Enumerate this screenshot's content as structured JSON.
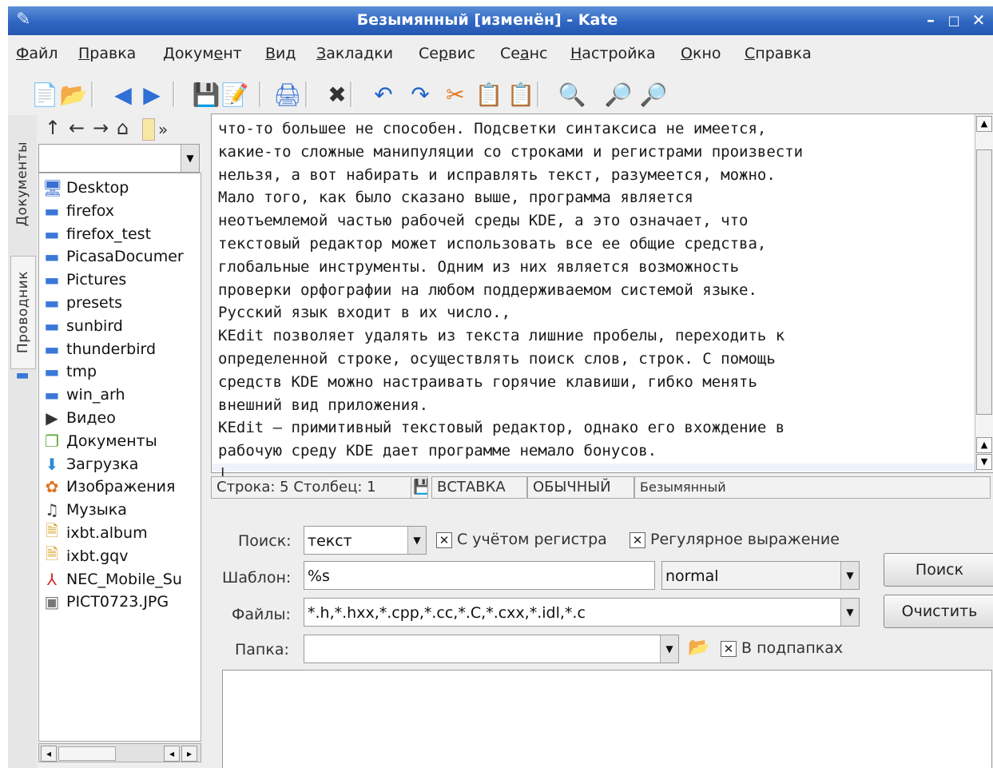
{
  "window": {
    "title": "Безымянный [изменён] - Kate",
    "controls": [
      "–",
      "□",
      "✕"
    ]
  },
  "menubar": [
    {
      "pre": "",
      "ul": "Ф",
      "post": "айл"
    },
    {
      "pre": "",
      "ul": "П",
      "post": "равка"
    },
    {
      "pre": "Докум",
      "ul": "е",
      "post": "нт"
    },
    {
      "pre": "",
      "ul": "В",
      "post": "ид"
    },
    {
      "pre": "",
      "ul": "З",
      "post": "акладки"
    },
    {
      "pre": "Се",
      "ul": "р",
      "post": "вис"
    },
    {
      "pre": "Се",
      "ul": "а",
      "post": "нс"
    },
    {
      "pre": "",
      "ul": "Н",
      "post": "астройка"
    },
    {
      "pre": "",
      "ul": "О",
      "post": "кно"
    },
    {
      "pre": "",
      "ul": "С",
      "post": "правка"
    }
  ],
  "toolbar": [
    {
      "icon": "new-document-icon",
      "glyph": "📄"
    },
    {
      "icon": "open-folder-icon",
      "glyph": "📂"
    },
    {
      "icon": "back-icon",
      "glyph": "◀"
    },
    {
      "icon": "forward-icon",
      "glyph": "▶"
    },
    {
      "icon": "save-icon",
      "glyph": "💾"
    },
    {
      "icon": "save-as-icon",
      "glyph": "📝"
    },
    {
      "icon": "print-icon",
      "glyph": "🖨"
    },
    {
      "icon": "close-document-icon",
      "glyph": "✖"
    },
    {
      "icon": "undo-icon",
      "glyph": "↶"
    },
    {
      "icon": "redo-icon",
      "glyph": "↷"
    },
    {
      "icon": "cut-icon",
      "glyph": "✂"
    },
    {
      "icon": "copy-icon",
      "glyph": "📋"
    },
    {
      "icon": "paste-icon",
      "glyph": "📋"
    },
    {
      "icon": "find-icon",
      "glyph": "🔍"
    },
    {
      "icon": "find-next-icon",
      "glyph": "🔎"
    },
    {
      "icon": "find-prev-icon",
      "glyph": "🔎"
    }
  ],
  "side_tabs": {
    "documents": "Документы",
    "explorer": "Проводник"
  },
  "file_browser": {
    "nav": [
      "↑",
      "←",
      "→",
      "⌂",
      "»"
    ],
    "path": "",
    "items": [
      {
        "name": "Desktop",
        "icon": "desktop-icon",
        "glyph": "🖥",
        "color": "#3b6fd1"
      },
      {
        "name": "firefox",
        "icon": "folder-icon",
        "glyph": "▬",
        "color": "#3a78d8"
      },
      {
        "name": "firefox_test",
        "icon": "folder-icon",
        "glyph": "▬",
        "color": "#3a78d8"
      },
      {
        "name": "PicasaDocumer",
        "icon": "folder-icon",
        "glyph": "▬",
        "color": "#3a78d8"
      },
      {
        "name": "Pictures",
        "icon": "folder-icon",
        "glyph": "▬",
        "color": "#3a78d8"
      },
      {
        "name": "presets",
        "icon": "folder-icon",
        "glyph": "▬",
        "color": "#3a78d8"
      },
      {
        "name": "sunbird",
        "icon": "folder-icon",
        "glyph": "▬",
        "color": "#3a78d8"
      },
      {
        "name": "thunderbird",
        "icon": "folder-icon",
        "glyph": "▬",
        "color": "#3a78d8"
      },
      {
        "name": "tmp",
        "icon": "folder-icon",
        "glyph": "▬",
        "color": "#3a78d8"
      },
      {
        "name": "win_arh",
        "icon": "folder-icon",
        "glyph": "▬",
        "color": "#3a78d8"
      },
      {
        "name": "Видео",
        "icon": "video-folder-icon",
        "glyph": "▶",
        "color": "#333333"
      },
      {
        "name": "Документы",
        "icon": "documents-folder-icon",
        "glyph": "❐",
        "color": "#5aa83a"
      },
      {
        "name": "Загрузка",
        "icon": "downloads-folder-icon",
        "glyph": "⬇",
        "color": "#2f8ad6"
      },
      {
        "name": "Изображения",
        "icon": "images-folder-icon",
        "glyph": "✿",
        "color": "#e0731c"
      },
      {
        "name": "Музыка",
        "icon": "music-folder-icon",
        "glyph": "♫",
        "color": "#444444"
      },
      {
        "name": "ixbt.album",
        "icon": "file-icon",
        "glyph": "🗎",
        "color": "#d6a020"
      },
      {
        "name": "ixbt.gqv",
        "icon": "file-icon",
        "glyph": "🗎",
        "color": "#d6a020"
      },
      {
        "name": "NEC_Mobile_Su",
        "icon": "pdf-file-icon",
        "glyph": "⅄",
        "color": "#d42a2a"
      },
      {
        "name": "PICT0723.JPG",
        "icon": "image-file-icon",
        "glyph": "▣",
        "color": "#777777"
      }
    ]
  },
  "editor": {
    "lines": [
      "что-то большее не способен. Подсветки синтаксиса не имеется,",
      "какие-то сложные манипуляции со строками и регистрами произвести",
      "нельзя, а вот набирать и исправлять текст, разумеется, можно.",
      "Мало того, как было сказано выше, программа является",
      "неотъемлемой частью рабочей среды KDE, а это означает, что",
      "текстовый редактор может использовать все ее общие средства,",
      "глобальные инструменты. Одним из них является возможность",
      "проверки орфографии на любом поддерживаемом системой языке.",
      "Русский язык входит в их число.,",
      "KEdit позволяет удалять из текста лишние пробелы, переходить к",
      "определенной строке, осуществлять поиск слов, строк. С помощь",
      "средств KDE можно настраивать горячие клавиши, гибко менять",
      "внешний вид приложения.",
      "KEdit — примитивный текстовый редактор, однако его вхождение в",
      "рабочую среду KDE дает программе немало бонусов.",
      "|"
    ]
  },
  "status": {
    "position": "Строка: 5 Столбец: 1",
    "mode": "ВСТАВКА",
    "type": "ОБЫЧНЫЙ",
    "doc": "Безымянный"
  },
  "find": {
    "search_label": "Поиск:",
    "search_value": "текст",
    "case_label": "С учётом регистра",
    "case_checked": true,
    "regex_label": "Регулярное выражение",
    "regex_checked": true,
    "template_label": "Шаблон:",
    "template_value": "%s",
    "template_mode": "normal",
    "files_label": "Файлы:",
    "files_value": "*.h,*.hxx,*.cpp,*.cc,*.C,*.cxx,*.idl,*.c",
    "folder_label": "Папка:",
    "folder_value": "",
    "subfolders_label": "В подпапках",
    "subfolders_checked": true,
    "search_button": "Поиск",
    "clear_button": "Очистить"
  }
}
